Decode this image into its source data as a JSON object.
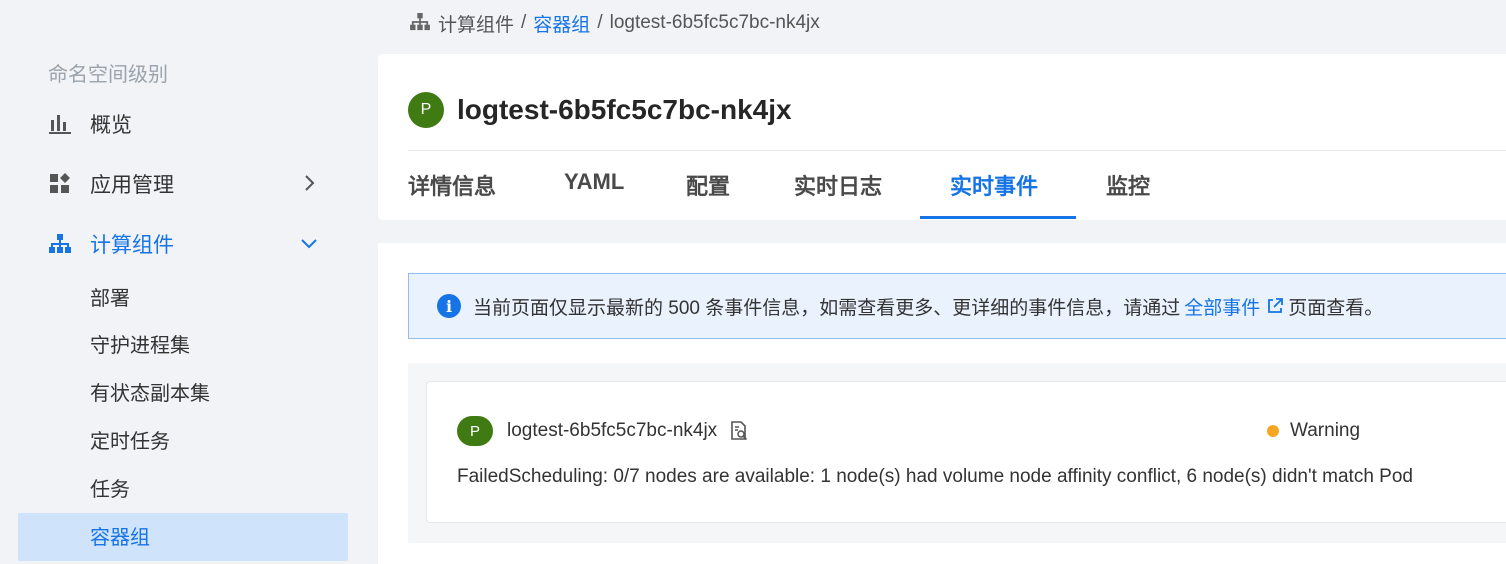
{
  "breadcrumb": {
    "items": [
      "计算组件",
      "容器组",
      "logtest-6b5fc5c7bc-nk4jx"
    ],
    "separator": "/"
  },
  "sidebar": {
    "section_label": "命名空间级别",
    "items": [
      {
        "label": "概览",
        "icon": "bar-chart-icon"
      },
      {
        "label": "应用管理",
        "icon": "apps-icon"
      },
      {
        "label": "计算组件",
        "icon": "hierarchy-icon"
      }
    ],
    "sub_items": [
      "部署",
      "守护进程集",
      "有状态副本集",
      "定时任务",
      "任务",
      "容器组"
    ],
    "active_sub_item": "容器组"
  },
  "pod": {
    "badge": "P",
    "name": "logtest-6b5fc5c7bc-nk4jx"
  },
  "tabs": [
    "详情信息",
    "YAML",
    "配置",
    "实时日志",
    "实时事件",
    "监控"
  ],
  "active_tab": "实时事件",
  "notice": {
    "prefix": "当前页面仅显示最新的 500 条事件信息，如需查看更多、更详细的事件信息，请通过",
    "link": "全部事件",
    "suffix": "页面查看。"
  },
  "events": [
    {
      "badge": "P",
      "name": "logtest-6b5fc5c7bc-nk4jx",
      "status": "Warning",
      "message": "FailedScheduling: 0/7 nodes are available: 1 node(s) had volume node affinity conflict, 6 node(s) didn't match Pod"
    }
  ],
  "colors": {
    "accent": "#1674e6",
    "pod_badge": "#3f7a12",
    "warning": "#f5a623"
  }
}
